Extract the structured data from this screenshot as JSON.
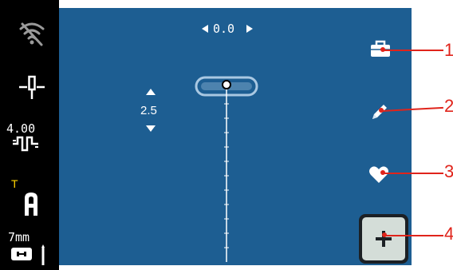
{
  "sidebar": {
    "tension_value": "4.00",
    "indicator_letter": "T",
    "foot_size": "7mm"
  },
  "main": {
    "offset_value": "0.0",
    "stitch_length": "2.5"
  },
  "callouts": [
    "1",
    "2",
    "3",
    "4"
  ],
  "colors": {
    "screen_bg": "#1d5e92",
    "sidebar_bg": "#000000",
    "accent_yellow": "#ffd400",
    "callout_red": "#e0241b",
    "add_button_bg": "#d4ddd8"
  },
  "icons": [
    "wifi-off-icon",
    "needle-position-icon",
    "tension-icon",
    "presser-foot-a-icon",
    "stitch-plate-icon",
    "memory-box-icon",
    "edit-pencil-icon",
    "favorite-heart-icon",
    "plus-icon"
  ]
}
